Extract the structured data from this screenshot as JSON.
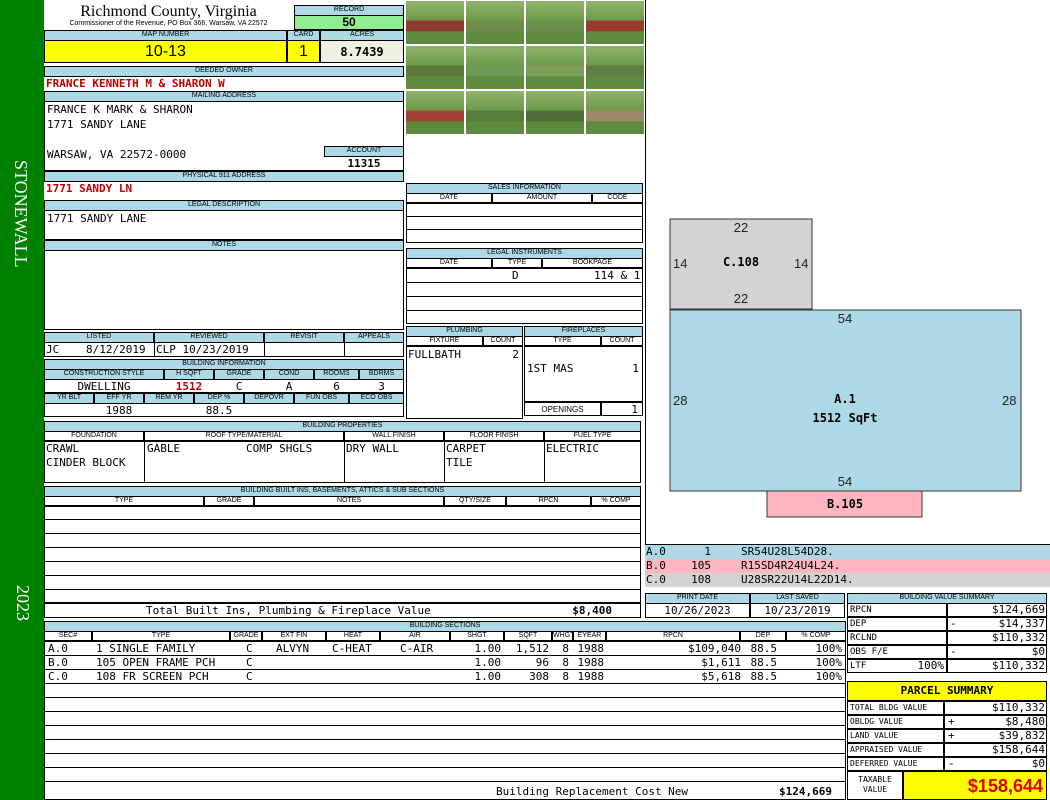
{
  "sidebar": {
    "district": "STONEWALL",
    "year": "2023"
  },
  "header": {
    "county": "Richmond County, Virginia",
    "commissioner": "Commissioner of the Revenue, PO Box 366, Warsaw, VA 22572",
    "record_label": "RECORD",
    "record": "50",
    "map_label": "MAP NUMBER",
    "map_number": "10-13",
    "card_label": "CARD",
    "card": "1",
    "acres_label": "ACRES",
    "acres": "8.7439"
  },
  "owner": {
    "label": "DEEDED OWNER",
    "name": "FRANCE KENNETH M & SHARON W"
  },
  "mailing": {
    "label": "MAILING ADDRESS",
    "line1": "FRANCE K MARK & SHARON",
    "line2": "1771 SANDY LANE",
    "line3": "WARSAW, VA 22572-0000",
    "account_label": "ACCOUNT",
    "account": "11315"
  },
  "physical": {
    "label": "PHYSICAL 911 ADDRESS",
    "address": "1771 SANDY LN"
  },
  "legal": {
    "label": "LEGAL DESCRIPTION",
    "text": "1771 SANDY LANE"
  },
  "notes": {
    "label": "NOTES"
  },
  "review": {
    "listed_label": "LISTED",
    "listed_by": "JC",
    "listed_date": "8/12/2019",
    "reviewed_label": "REVIEWED",
    "reviewed": "CLP 10/23/2019",
    "revisit_label": "REVISIT",
    "appeals_label": "APPEALS"
  },
  "building_info": {
    "label": "BUILDING INFORMATION",
    "construction_style_label": "CONSTRUCTION STYLE",
    "construction_style": "DWELLING",
    "hsqft_label": "H SQFT",
    "hsqft": "1512",
    "grade_label": "GRADE",
    "grade": "C",
    "cond_label": "COND",
    "cond": "A",
    "rooms_label": "ROOMS",
    "rooms": "6",
    "bdrms_label": "BDRMS",
    "bdrms": "3",
    "yrblt_label": "YR BLT",
    "effyr_label": "EFF YR",
    "effyr": "1988",
    "remyr_label": "REM YR",
    "dep_label": "DEP %",
    "dep": "88.5",
    "depovr_label": "DEPOVR",
    "funobs_label": "FUN OBS",
    "ecoobs_label": "ECO OBS"
  },
  "properties": {
    "label": "BUILDING PROPERTIES",
    "foundation_label": "FOUNDATION",
    "foundation1": "CRAWL",
    "foundation2": "CINDER BLOCK",
    "roof_label": "ROOF TYPE/MATERIAL",
    "roof_type": "GABLE",
    "roof_material": "COMP SHGLS",
    "wall_label": "WALL FINISH",
    "wall": "DRY WALL",
    "floor_label": "FLOOR FINISH",
    "floor1": "CARPET",
    "floor2": "TILE",
    "fuel_label": "FUEL TYPE",
    "fuel": "ELECTRIC"
  },
  "builtins": {
    "label": "BUILDING BUILT INS, BASEMENTS, ATTICS & SUB SECTIONS",
    "cols": [
      "TYPE",
      "GRADE",
      "NOTES",
      "QTY/SIZE",
      "RPCN",
      "% COMP"
    ],
    "total_label": "Total Built Ins, Plumbing & Fireplace Value",
    "total": "$8,400"
  },
  "sales": {
    "label": "SALES INFORMATION",
    "cols": [
      "DATE",
      "AMOUNT",
      "CODE"
    ]
  },
  "instruments": {
    "label": "LEGAL INSTRUMENTS",
    "cols": [
      "DATE",
      "TYPE",
      "BOOKPAGE"
    ],
    "type": "D",
    "bookpage": "114 & 1"
  },
  "plumbing": {
    "label": "PLUMBING",
    "fixture_label": "FIXTURE",
    "count_label": "COUNT",
    "fixture": "FULLBATH",
    "count": "2"
  },
  "fireplaces": {
    "label": "FIREPLACES",
    "type_label": "TYPE",
    "count_label": "COUNT",
    "type": "1ST MAS",
    "count": "1",
    "openings_label": "OPENINGS",
    "openings": "1"
  },
  "sketch": {
    "c108": {
      "label": "C.108",
      "top": "22",
      "bottom": "22",
      "left": "14",
      "right": "14"
    },
    "a1": {
      "label": "A.1",
      "area": "1512 SqFt",
      "top": "54",
      "bottom": "54",
      "left": "28",
      "right": "28"
    },
    "b105": {
      "label": "B.105"
    },
    "colors": {
      "a": "#add8e6",
      "b": "#ffb6c1",
      "c": "#d3d3d3"
    },
    "legend": [
      {
        "id": "A.0",
        "num": "1",
        "code": "SR54U28L54D28."
      },
      {
        "id": "B.0",
        "num": "105",
        "code": "R15SD4R24U4L24."
      },
      {
        "id": "C.0",
        "num": "108",
        "code": "U28SR22U14L22D14."
      }
    ]
  },
  "dates": {
    "print_label": "PRINT DATE",
    "print": "10/26/2023",
    "saved_label": "LAST SAVED",
    "saved": "10/23/2019"
  },
  "sections": {
    "label": "BUILDING SECTIONS",
    "cols": [
      "SEC#",
      "TYPE",
      "GRADE",
      "EXT FIN",
      "HEAT",
      "AIR",
      "SHGT",
      "SQFT",
      "WHGT",
      "EYEAR",
      "RPCN",
      "DEP",
      "% COMP"
    ],
    "rows": [
      {
        "sec": "A.0",
        "type": "1 SINGLE FAMILY",
        "grade": "C",
        "extfin": "ALVYN",
        "heat": "C-HEAT",
        "air": "C-AIR",
        "shgt": "1.00",
        "sqft": "1,512",
        "whgt": "8",
        "eyear": "1988",
        "rpcn": "$109,040",
        "dep": "88.5",
        "comp": "100%"
      },
      {
        "sec": "B.0",
        "type": "105 OPEN FRAME PCH",
        "grade": "C",
        "extfin": "",
        "heat": "",
        "air": "",
        "shgt": "1.00",
        "sqft": "96",
        "whgt": "8",
        "eyear": "1988",
        "rpcn": "$1,611",
        "dep": "88.5",
        "comp": "100%"
      },
      {
        "sec": "C.0",
        "type": "108 FR SCREEN PCH",
        "grade": "C",
        "extfin": "",
        "heat": "",
        "air": "",
        "shgt": "1.00",
        "sqft": "308",
        "whgt": "8",
        "eyear": "1988",
        "rpcn": "$5,618",
        "dep": "88.5",
        "comp": "100%"
      }
    ],
    "replacement_label": "Building Replacement Cost New",
    "replacement": "$124,669"
  },
  "value_summary": {
    "label": "BUILDING VALUE SUMMARY",
    "rows": [
      {
        "label": "RPCN",
        "sign": "",
        "pct": "",
        "value": "$124,669"
      },
      {
        "label": "DEP",
        "sign": "-",
        "pct": "",
        "value": "$14,337"
      },
      {
        "label": "RCLND",
        "sign": "",
        "pct": "",
        "value": "$110,332"
      },
      {
        "label": "OBS F/E",
        "sign": "-",
        "pct": "",
        "value": "$0"
      },
      {
        "label": "LTF",
        "sign": "",
        "pct": "100%",
        "value": "$110,332"
      }
    ]
  },
  "parcel": {
    "label": "PARCEL SUMMARY",
    "rows": [
      {
        "label": "TOTAL BLDG VALUE",
        "sign": "",
        "value": "$110,332"
      },
      {
        "label": "OBLDG VALUE",
        "sign": "+",
        "value": "$8,480"
      },
      {
        "label": "LAND VALUE",
        "sign": "+",
        "value": "$39,832"
      },
      {
        "label": "APPRAISED VALUE",
        "sign": "",
        "value": "$158,644"
      },
      {
        "label": "DEFERRED VALUE",
        "sign": "-",
        "value": "$0"
      }
    ],
    "taxable_label1": "TAXABLE",
    "taxable_label2": "VALUE",
    "taxable": "$158,644"
  },
  "photos": [
    {
      "name": "house-photo-1",
      "c": "#8c3b2e"
    },
    {
      "name": "house-photo-2",
      "c": "#6f8c4a"
    },
    {
      "name": "house-photo-3",
      "c": "#6b8f4e"
    },
    {
      "name": "house-photo-4",
      "c": "#9a3a2c"
    },
    {
      "name": "house-photo-5",
      "c": "#5c7a3a"
    },
    {
      "name": "house-photo-6",
      "c": "#6d9a55"
    },
    {
      "name": "house-photo-7",
      "c": "#7aa05c"
    },
    {
      "name": "house-photo-8",
      "c": "#5e7e44"
    },
    {
      "name": "house-photo-9",
      "c": "#a34234"
    },
    {
      "name": "house-photo-10",
      "c": "#567f3d"
    },
    {
      "name": "house-photo-11",
      "c": "#4f6e36"
    },
    {
      "name": "house-photo-12",
      "c": "#9c8a6a"
    }
  ]
}
